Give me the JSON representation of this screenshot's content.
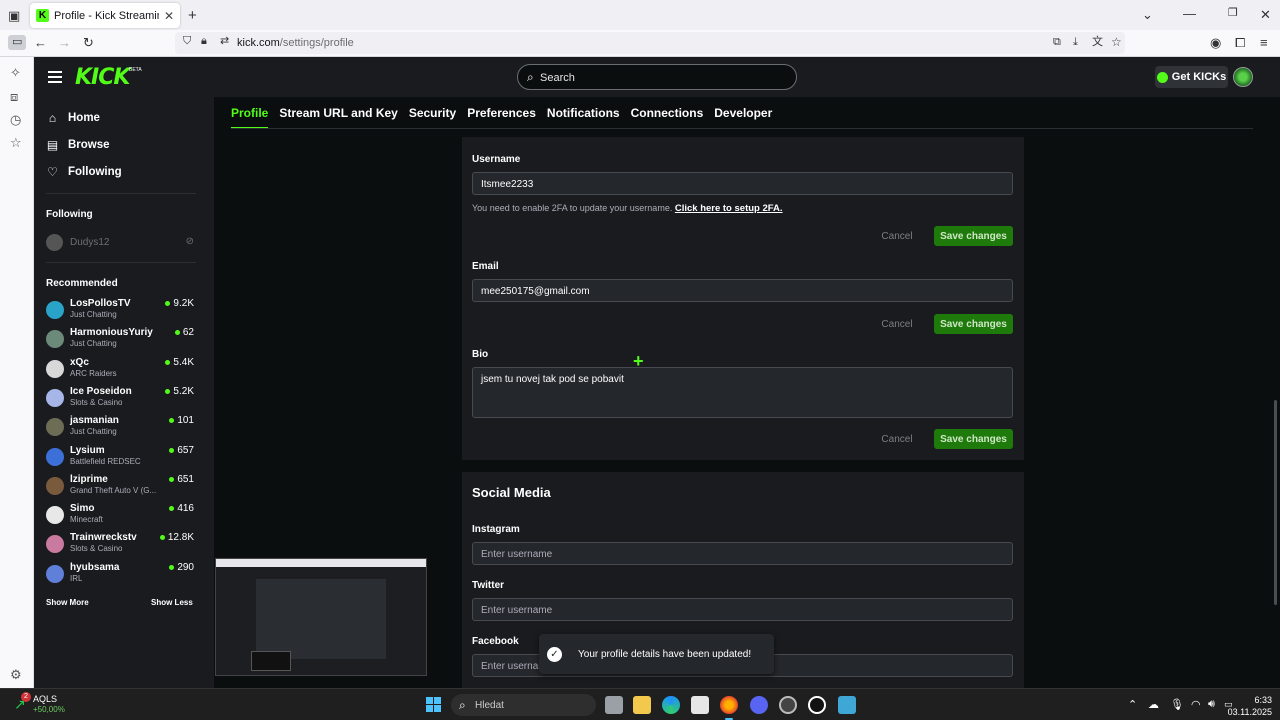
{
  "browser": {
    "tab_title": "Profile - Kick Streaming",
    "tab_favicon": "K",
    "url_host": "kick.com",
    "url_path": "/settings/profile"
  },
  "header": {
    "logo": "KICK",
    "beta": "BETA",
    "search_placeholder": "Search",
    "get_kicks": "Get KICKs"
  },
  "nav": {
    "items": [
      {
        "label": "Home",
        "icon": "home-icon"
      },
      {
        "label": "Browse",
        "icon": "compass-icon"
      },
      {
        "label": "Following",
        "icon": "heart-icon"
      }
    ],
    "following_heading": "Following",
    "followed": [
      {
        "name": "Dudys12"
      }
    ],
    "recommended_heading": "Recommended",
    "recommended": [
      {
        "name": "LosPollosTV",
        "category": "Just Chatting",
        "viewers": "9.2K",
        "color": "#2aa3c9"
      },
      {
        "name": "HarmoniousYuriy",
        "category": "Just Chatting",
        "viewers": "62",
        "color": "#6c8a7a"
      },
      {
        "name": "xQc",
        "category": "ARC Raiders",
        "viewers": "5.4K",
        "color": "#d8d8d8"
      },
      {
        "name": "Ice Poseidon",
        "category": "Slots & Casino",
        "viewers": "5.2K",
        "color": "#a7b6e8"
      },
      {
        "name": "jasmanian",
        "category": "Just Chatting",
        "viewers": "101",
        "color": "#6d6d55"
      },
      {
        "name": "Lysium",
        "category": "Battlefield REDSEC",
        "viewers": "657",
        "color": "#3d6fd8"
      },
      {
        "name": "lziprime",
        "category": "Grand Theft Auto V (G...",
        "viewers": "651",
        "color": "#7a5a3c"
      },
      {
        "name": "Simo",
        "category": "Minecraft",
        "viewers": "416",
        "color": "#e8e8e8"
      },
      {
        "name": "Trainwreckstv",
        "category": "Slots & Casino",
        "viewers": "12.8K",
        "color": "#c87aa0"
      },
      {
        "name": "hyubsama",
        "category": "IRL",
        "viewers": "290",
        "color": "#5f7fd8"
      }
    ],
    "show_more": "Show More",
    "show_less": "Show Less"
  },
  "settings": {
    "tabs": [
      "Profile",
      "Stream URL and Key",
      "Security",
      "Preferences",
      "Notifications",
      "Connections",
      "Developer"
    ],
    "active_tab": "Profile",
    "username_label": "Username",
    "username_value": "Itsmee2233",
    "username_hint": "You need to enable 2FA to update your username.",
    "username_hint_link": "Click here to setup 2FA.",
    "cancel": "Cancel",
    "save": "Save changes",
    "email_label": "Email",
    "email_value": "mee250175@gmail.com",
    "bio_label": "Bio",
    "bio_value": "jsem tu novej tak pod se pobavit",
    "social_heading": "Social Media",
    "instagram_label": "Instagram",
    "twitter_label": "Twitter",
    "facebook_label": "Facebook",
    "social_placeholder": "Enter username"
  },
  "toast": {
    "message": "Your profile details have been updated!"
  },
  "taskbar": {
    "stock_symbol": "AQLS",
    "stock_change": "+50,00%",
    "stock_badge": "2",
    "search_placeholder": "Hledat",
    "time": "6:33",
    "date": "03.11.2025"
  },
  "colors": {
    "accent": "#53fc18",
    "panel": "#191b1f",
    "background": "#0b0e0f"
  }
}
